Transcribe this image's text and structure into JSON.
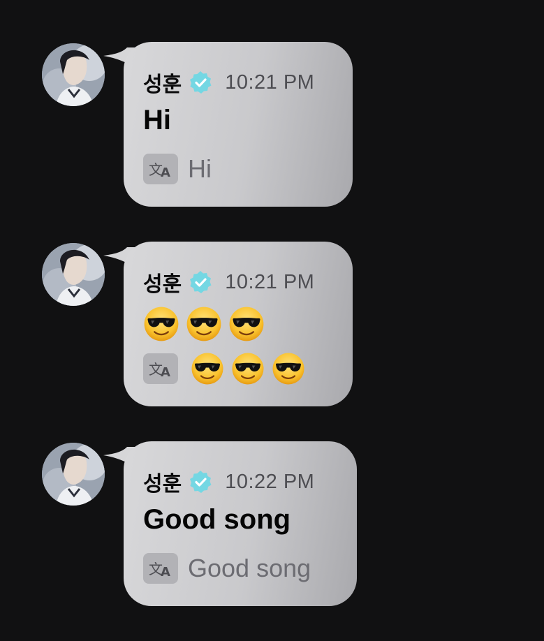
{
  "messages": [
    {
      "sender": "성훈",
      "verified_icon": "verified-check-icon",
      "time": "10:21 PM",
      "text": "Hi",
      "translation": "Hi"
    },
    {
      "sender": "성훈",
      "verified_icon": "verified-check-icon",
      "time": "10:21 PM",
      "emoji": [
        "😎",
        "😎",
        "😎"
      ],
      "translation_emoji": [
        "😎",
        "😎",
        "😎"
      ]
    },
    {
      "sender": "성훈",
      "verified_icon": "verified-check-icon",
      "time": "10:22 PM",
      "text": "Good song",
      "translation": "Good song"
    }
  ],
  "colors": {
    "background": "#111112",
    "bubble": "#c9c9cc",
    "verified": "#74d7e3",
    "time": "#4d4d52",
    "translation_text": "#6c6c72"
  }
}
